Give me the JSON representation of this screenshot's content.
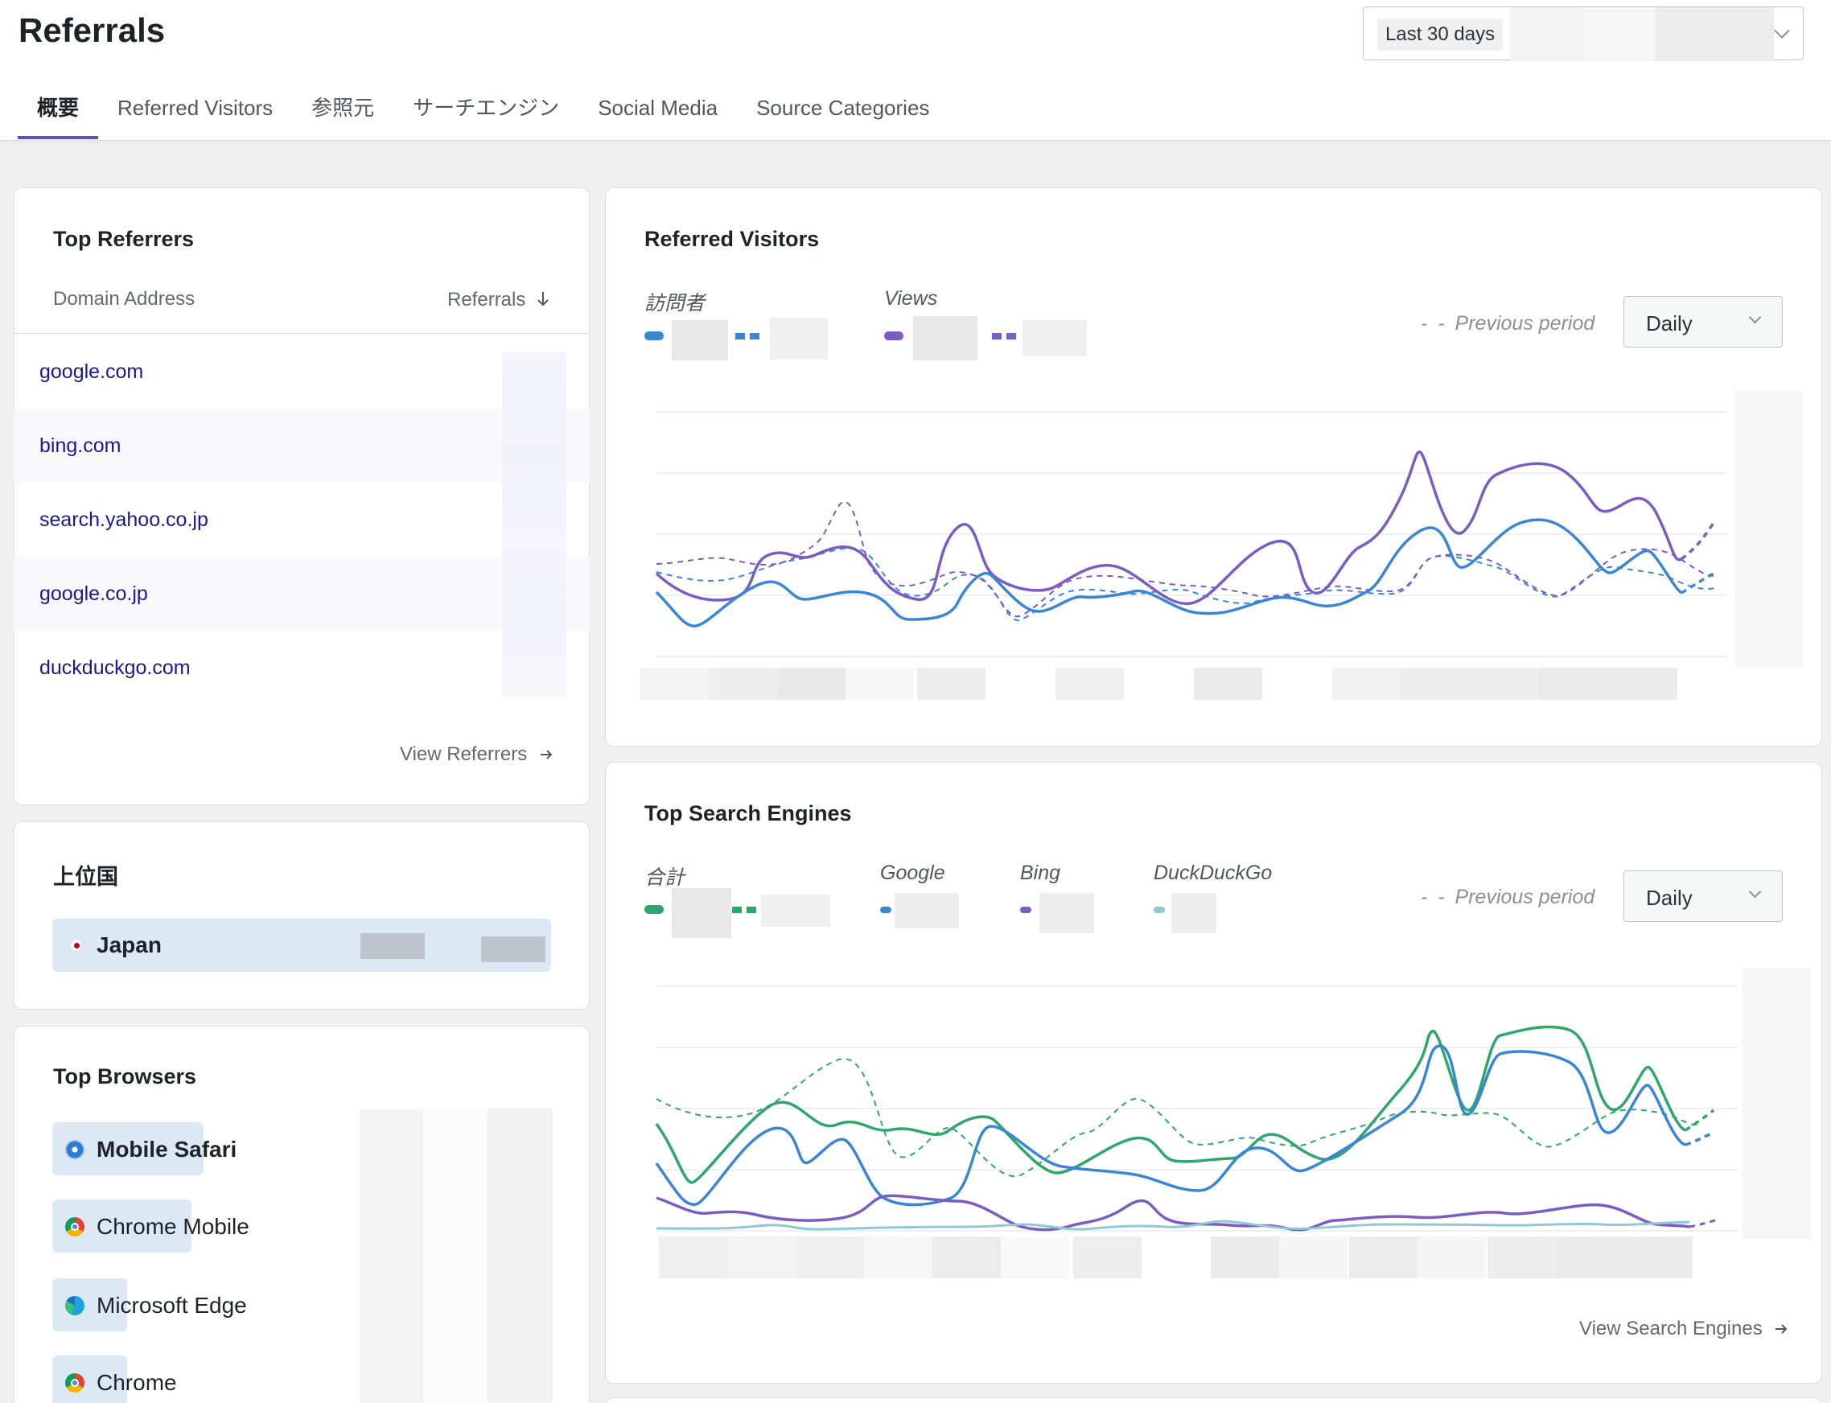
{
  "header": {
    "title": "Referrals",
    "date_range": "Last 30 days",
    "tabs": [
      "概要",
      "Referred Visitors",
      "参照元",
      "サーチエンジン",
      "Social Media",
      "Source Categories"
    ]
  },
  "top_referrers": {
    "title": "Top Referrers",
    "col_domain": "Domain Address",
    "col_referrals": "Referrals",
    "sort_icon": "arrow-down-icon",
    "rows": [
      "google.com",
      "bing.com",
      "search.yahoo.co.jp",
      "google.co.jp",
      "duckduckgo.com"
    ],
    "view_link": "View Referrers"
  },
  "top_countries": {
    "title": "上位国",
    "rows": [
      "Japan"
    ]
  },
  "top_browsers": {
    "title": "Top Browsers",
    "rows": [
      "Mobile Safari",
      "Chrome Mobile",
      "Microsoft Edge",
      "Chrome"
    ]
  },
  "referred_visitors": {
    "title": "Referred Visitors",
    "legend_visitors": "訪問者",
    "legend_views": "Views",
    "previous_period": "Previous period",
    "interval": "Daily",
    "colors": {
      "visitors": "#3a86d6",
      "views": "#7b5cc4"
    }
  },
  "top_search_engines": {
    "title": "Top Search Engines",
    "legend_total": "合計",
    "legend_google": "Google",
    "legend_bing": "Bing",
    "legend_ddg": "DuckDuckGo",
    "previous_period": "Previous period",
    "interval": "Daily",
    "view_link": "View Search Engines",
    "colors": {
      "total": "#2ea86a",
      "google": "#3a86d6",
      "bing": "#7b5cc4",
      "duckduckgo": "#8ec9d4"
    }
  }
}
